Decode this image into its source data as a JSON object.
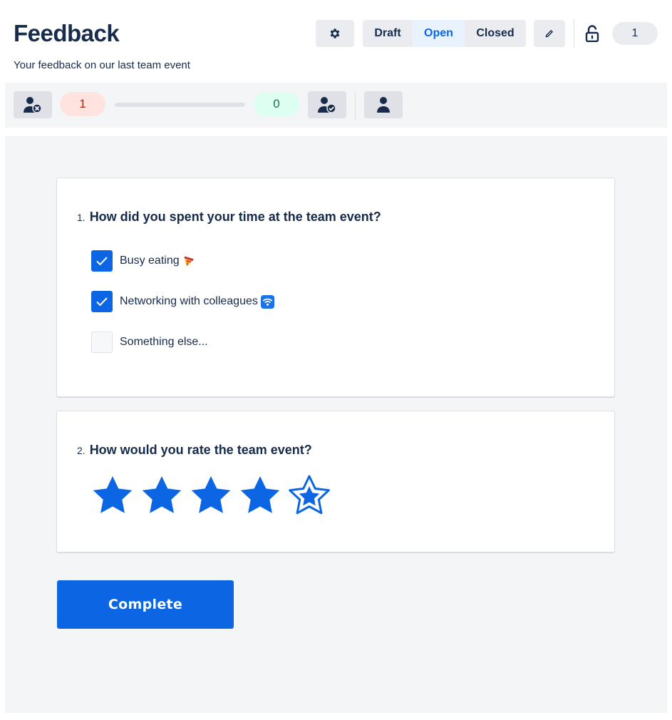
{
  "header": {
    "title": "Feedback",
    "subtitle": "Your feedback on our last team event",
    "status_tabs": [
      {
        "label": "Draft",
        "active": false
      },
      {
        "label": "Open",
        "active": true
      },
      {
        "label": "Closed",
        "active": false
      }
    ],
    "response_count": "1",
    "icons": {
      "settings": "gear-icon",
      "edit": "pencil-icon",
      "lock": "unlock-icon"
    }
  },
  "toolbar": {
    "incomplete_count": "1",
    "complete_count": "0",
    "progress_fraction": 0,
    "icons": {
      "incomplete": "user-remove-icon",
      "complete": "user-check-icon",
      "single": "user-icon"
    }
  },
  "questions": [
    {
      "number": "1.",
      "title": "How did you spent your time at the team event?",
      "options": [
        {
          "label": "Busy eating",
          "checked": true,
          "emoji_icon": "pizza-icon"
        },
        {
          "label": "Networking with colleagues",
          "checked": true,
          "emoji_icon": "wifi-icon"
        },
        {
          "label": "Something else...",
          "checked": false
        }
      ]
    },
    {
      "number": "2.",
      "title": "How would you rate the team event?",
      "rating": 4,
      "rating_max": 5
    }
  ],
  "actions": {
    "complete_label": "Complete"
  },
  "colors": {
    "accent": "#0c66e4",
    "red_pill": "#ffe3df",
    "green_pill": "#dcfff1",
    "canvas": "#f4f5f7"
  }
}
